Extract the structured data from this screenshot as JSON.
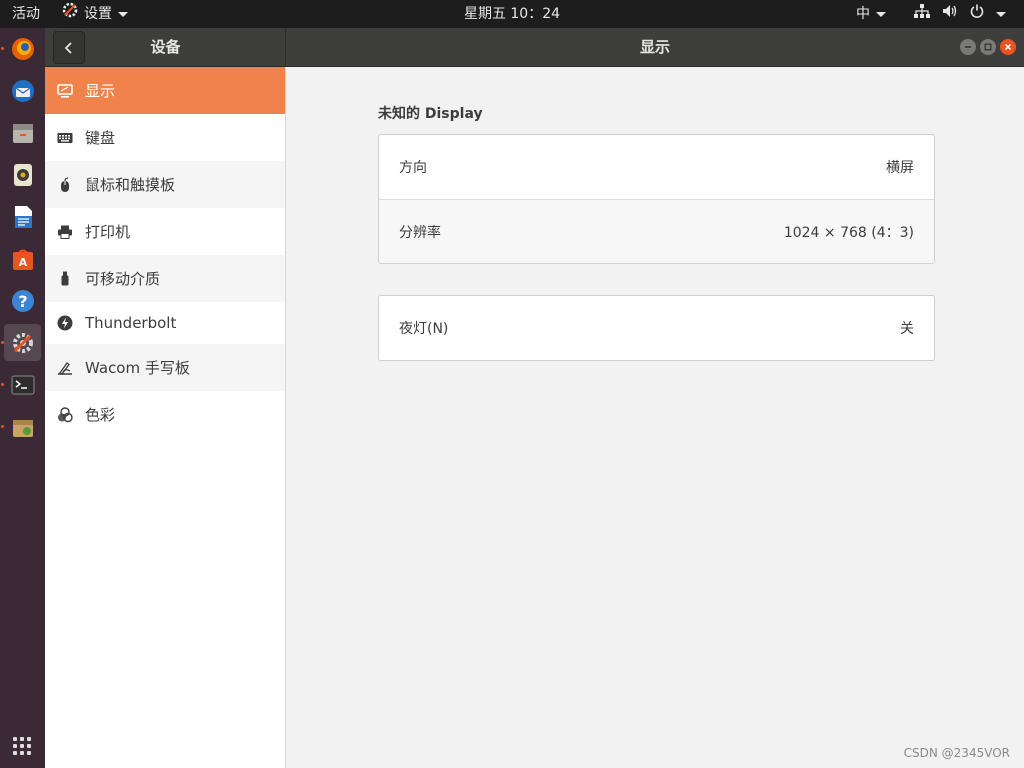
{
  "topbar": {
    "activities": "活动",
    "app_name": "设置",
    "clock": "星期五 10：24",
    "input_method": "中"
  },
  "header": {
    "sidebar_title": "设备",
    "content_title": "显示"
  },
  "sidebar": {
    "items": [
      {
        "label": "显示",
        "icon": "display-icon"
      },
      {
        "label": "键盘",
        "icon": "keyboard-icon"
      },
      {
        "label": "鼠标和触摸板",
        "icon": "mouse-icon"
      },
      {
        "label": "打印机",
        "icon": "printer-icon"
      },
      {
        "label": "可移动介质",
        "icon": "usb-drive-icon"
      },
      {
        "label": "Thunderbolt",
        "icon": "thunderbolt-icon"
      },
      {
        "label": "Wacom 手写板",
        "icon": "tablet-icon"
      },
      {
        "label": "色彩",
        "icon": "color-icon"
      }
    ]
  },
  "display": {
    "section_title": "未知的 Display",
    "rows": [
      {
        "label": "方向",
        "value": "横屏"
      },
      {
        "label": "分辨率",
        "value": "1024 × 768 (4：3)"
      }
    ],
    "night_light": {
      "label": "夜灯(N)",
      "value": "关"
    }
  },
  "dock": {
    "items": [
      "firefox-icon",
      "thunderbird-icon",
      "files-icon",
      "rhythmbox-icon",
      "libreoffice-writer-icon",
      "software-center-icon",
      "help-icon",
      "settings-icon",
      "terminal-icon",
      "archive-icon"
    ]
  },
  "watermark": "CSDN @2345VOR",
  "colors": {
    "accent": "#f0824c",
    "close": "#e95420",
    "dock": "#3b2a35"
  }
}
